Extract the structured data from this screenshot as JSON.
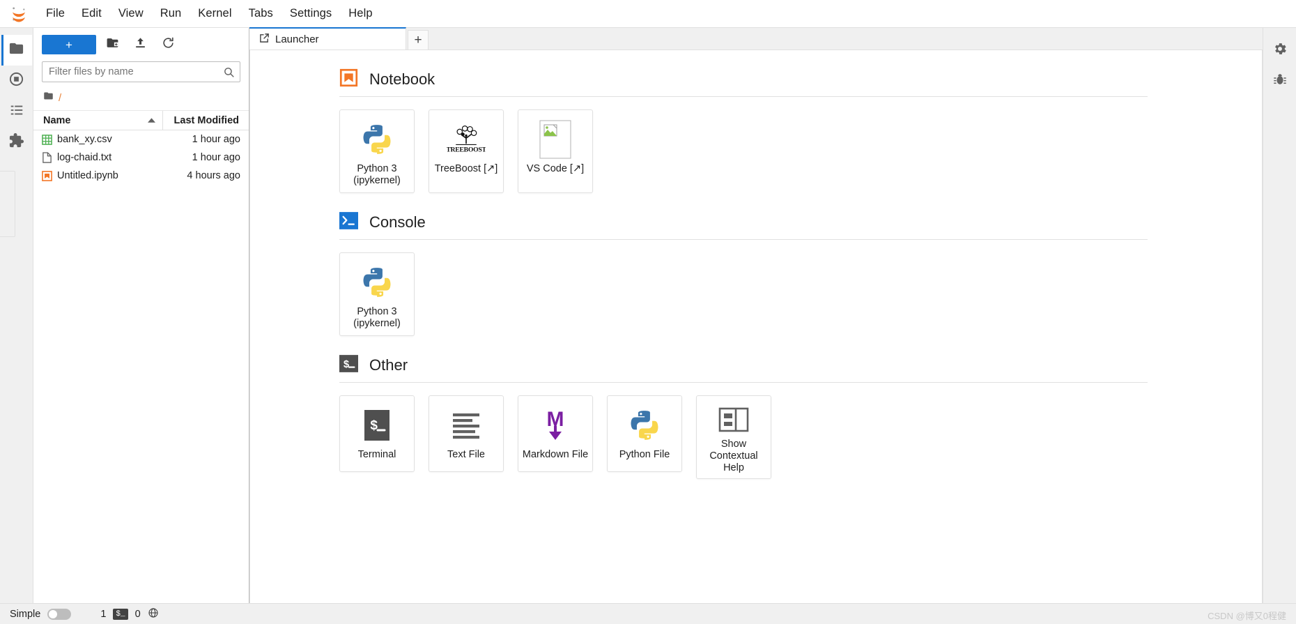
{
  "app": {
    "logo_icon": "jupyter-logo"
  },
  "menubar": {
    "items": [
      {
        "label": "File",
        "name": "menu-file"
      },
      {
        "label": "Edit",
        "name": "menu-edit"
      },
      {
        "label": "View",
        "name": "menu-view"
      },
      {
        "label": "Run",
        "name": "menu-run"
      },
      {
        "label": "Kernel",
        "name": "menu-kernel"
      },
      {
        "label": "Tabs",
        "name": "menu-tabs"
      },
      {
        "label": "Settings",
        "name": "menu-settings"
      },
      {
        "label": "Help",
        "name": "menu-help"
      }
    ]
  },
  "left_rail": {
    "items": [
      {
        "icon": "folder-icon",
        "name": "sidebar-tab-file-browser",
        "active": true
      },
      {
        "icon": "running-terminals-icon",
        "name": "sidebar-tab-running"
      },
      {
        "icon": "table-of-contents-icon",
        "name": "sidebar-tab-toc"
      },
      {
        "icon": "extension-puzzle-icon",
        "name": "sidebar-tab-extensions"
      }
    ]
  },
  "right_rail": {
    "items": [
      {
        "icon": "property-inspector-icon",
        "name": "sidebar-tab-property-inspector"
      },
      {
        "icon": "debugger-bug-icon",
        "name": "sidebar-tab-debugger"
      }
    ]
  },
  "filebrowser": {
    "toolbar": {
      "new_label": "+",
      "new_folder_icon": "new-folder-icon",
      "upload_icon": "upload-icon",
      "refresh_icon": "refresh-icon"
    },
    "filter": {
      "placeholder": "Filter files by name",
      "value": "",
      "search_icon": "search-icon"
    },
    "breadcrumb": {
      "home_icon": "folder-icon",
      "path": "/"
    },
    "columns": {
      "name": "Name",
      "last_modified": "Last Modified",
      "sort_icon": "sort-ascending-caret"
    },
    "files": [
      {
        "name": "bank_xy.csv",
        "modified": "1 hour ago",
        "icon": "spreadsheet-icon"
      },
      {
        "name": "log-chaid.txt",
        "modified": "1 hour ago",
        "icon": "text-file-icon"
      },
      {
        "name": "Untitled.ipynb",
        "modified": "4 hours ago",
        "icon": "notebook-icon"
      }
    ]
  },
  "tabbar": {
    "tabs": [
      {
        "label": "Launcher",
        "icon": "launcher-icon",
        "active": true
      }
    ],
    "add_tab_label": "+"
  },
  "launcher": {
    "sections": [
      {
        "title": "Notebook",
        "icon": "notebook-bookmark-icon",
        "cards": [
          {
            "label": "Python 3\n(ipykernel)",
            "icon": "python-logo",
            "name": "launcher-card-python3-notebook"
          },
          {
            "label": "TreeBoost [↗]",
            "icon": "treeboost-logo",
            "name": "launcher-card-treeboost"
          },
          {
            "label": "VS Code [↗]",
            "icon": "broken-image-icon",
            "name": "launcher-card-vscode"
          }
        ]
      },
      {
        "title": "Console",
        "icon": "console-prompt-icon",
        "cards": [
          {
            "label": "Python 3\n(ipykernel)",
            "icon": "python-logo",
            "name": "launcher-card-python3-console"
          }
        ]
      },
      {
        "title": "Other",
        "icon": "terminal-prompt-icon",
        "cards": [
          {
            "label": "Terminal",
            "icon": "terminal-icon",
            "name": "launcher-card-terminal"
          },
          {
            "label": "Text File",
            "icon": "text-lines-icon",
            "name": "launcher-card-text-file"
          },
          {
            "label": "Markdown File",
            "icon": "markdown-icon",
            "name": "launcher-card-markdown-file"
          },
          {
            "label": "Python File",
            "icon": "python-logo",
            "name": "launcher-card-python-file"
          },
          {
            "label": "Show\nContextual\nHelp",
            "icon": "contextual-help-icon",
            "name": "launcher-card-contextual-help"
          }
        ]
      }
    ]
  },
  "statusbar": {
    "mode_label": "Simple",
    "mode_enabled": false,
    "terminals_count": "1",
    "kernel_badge": "$_",
    "kernels_count": "0",
    "globe_icon": "globe-icon",
    "watermark": "CSDN @博又0程健"
  },
  "colors": {
    "accent_blue": "#1976d2",
    "jupyter_orange": "#f37626",
    "csv_green": "#4caf50",
    "markdown_purple": "#7b1fa2",
    "terminal_dark": "#424242"
  }
}
